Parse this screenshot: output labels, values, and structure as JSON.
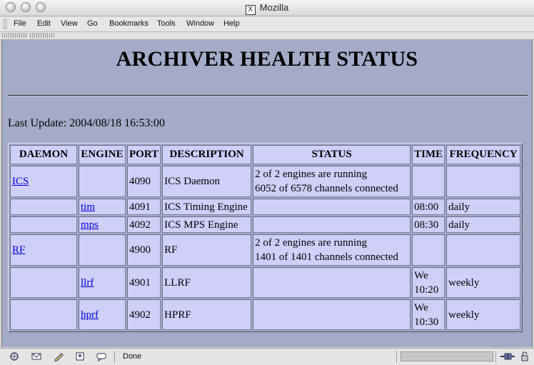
{
  "window": {
    "title": "Mozilla"
  },
  "menu": [
    "File",
    "Edit",
    "View",
    "Go",
    "Bookmarks",
    "Tools",
    "Window",
    "Help"
  ],
  "page": {
    "title": "ARCHIVER HEALTH STATUS",
    "last_update": "Last Update: 2004/08/18 16:53:00"
  },
  "table": {
    "headers": [
      "DAEMON",
      "ENGINE",
      "PORT",
      "DESCRIPTION",
      "STATUS",
      "TIME",
      "FREQUENCY"
    ],
    "rows": [
      {
        "daemon": "ICS",
        "engine": "",
        "port": "4090",
        "description": "ICS Daemon",
        "status1": "2 of 2 engines are running",
        "status2": "6052 of 6578 channels connected",
        "time1": "",
        "time2": "",
        "frequency": ""
      },
      {
        "daemon": "",
        "engine": "tim",
        "port": "4091",
        "description": "ICS Timing Engine",
        "status1": "",
        "status2": "",
        "time1": "08:00",
        "time2": "",
        "frequency": "daily"
      },
      {
        "daemon": "",
        "engine": "mps",
        "port": "4092",
        "description": "ICS MPS Engine",
        "status1": "",
        "status2": "",
        "time1": "08:30",
        "time2": "",
        "frequency": "daily"
      },
      {
        "daemon": "RF",
        "engine": "",
        "port": "4900",
        "description": "RF",
        "status1": "2 of 2 engines are running",
        "status2": "1401 of 1401 channels connected",
        "time1": "",
        "time2": "",
        "frequency": ""
      },
      {
        "daemon": "",
        "engine": "llrf",
        "port": "4901",
        "description": "LLRF",
        "status1": "",
        "status2": "",
        "time1": "We",
        "time2": "10:20",
        "frequency": "weekly"
      },
      {
        "daemon": "",
        "engine": "hprf",
        "port": "4902",
        "description": "HPRF",
        "status1": "",
        "status2": "",
        "time1": "We",
        "time2": "10:30",
        "frequency": "weekly"
      }
    ]
  },
  "statusbar": {
    "text": "Done",
    "icons": [
      "navigator-icon",
      "mail-icon",
      "composer-icon",
      "address-book-icon",
      "chat-icon"
    ]
  },
  "colors": {
    "page_bg": "#a4abc8",
    "cell_bg": "#cfcff8",
    "link": "#0000cc"
  }
}
